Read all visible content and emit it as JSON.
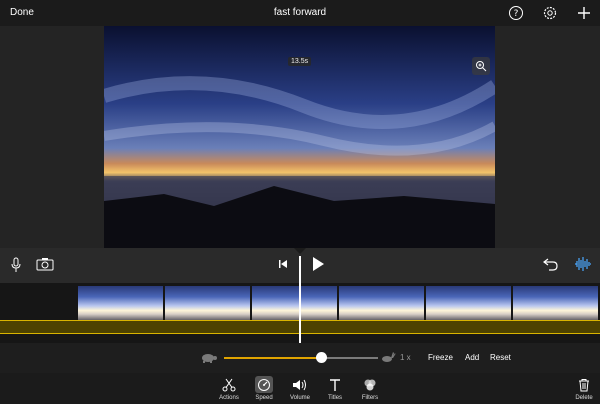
{
  "topbar": {
    "done_label": "Done",
    "title": "fast forward"
  },
  "icons": {
    "help": "help-icon",
    "settings": "settings-icon",
    "add": "add-icon",
    "zoom": "zoom-in-icon",
    "mic": "microphone-icon",
    "camera": "camera-icon",
    "skip_back": "skip-to-start-icon",
    "play": "play-icon",
    "undo": "undo-icon",
    "audio": "audio-waveform-icon"
  },
  "preview": {
    "duration": "13.5s"
  },
  "speed": {
    "value_label": "1 x",
    "slider_level": 0.63,
    "freeze_label": "Freeze",
    "add_label": "Add",
    "reset_label": "Reset",
    "accent": "#e0a400"
  },
  "tabs": [
    {
      "label": "Actions",
      "icon": "scissors-icon"
    },
    {
      "label": "Speed",
      "icon": "speedometer-icon"
    },
    {
      "label": "Volume",
      "icon": "speaker-icon"
    },
    {
      "label": "Titles",
      "icon": "text-t-icon"
    },
    {
      "label": "Filters",
      "icon": "filters-icon"
    }
  ],
  "delete_label": "Delete"
}
